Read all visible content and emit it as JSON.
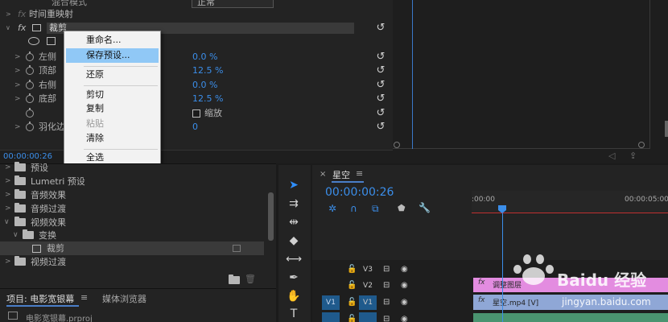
{
  "effect_controls": {
    "blend_label": "混合模式",
    "blend_value": "正常",
    "time_remap": "时间重映射",
    "crop_name": "裁剪",
    "properties": [
      {
        "label": "左侧",
        "value": "0.0 %"
      },
      {
        "label": "顶部",
        "value": "12.5 %"
      },
      {
        "label": "右侧",
        "value": "0.0 %"
      },
      {
        "label": "底部",
        "value": "12.5 %"
      }
    ],
    "zoom_label": "缩放",
    "feather_label": "羽化边",
    "feather_value": "0",
    "timecode": "00:00:00:26",
    "fx_mark": "fx",
    "reset_icon": "↺"
  },
  "context_menu": {
    "items": [
      "重命名...",
      "保存预设...",
      "还原",
      "剪切",
      "复制",
      "粘贴",
      "清除",
      "全选"
    ],
    "highlighted": 1,
    "disabled": [
      5
    ]
  },
  "effects_panel": {
    "items": [
      {
        "label": "预设",
        "level": 0,
        "open": false
      },
      {
        "label": "Lumetri 预设",
        "level": 0,
        "open": false
      },
      {
        "label": "音频效果",
        "level": 0,
        "open": false
      },
      {
        "label": "音频过渡",
        "level": 0,
        "open": false
      },
      {
        "label": "视频效果",
        "level": 0,
        "open": true
      },
      {
        "label": "变换",
        "level": 1,
        "open": true
      },
      {
        "label": "裁剪",
        "level": 2,
        "open": false
      },
      {
        "label": "视频过渡",
        "level": 0,
        "open": false
      }
    ]
  },
  "project_panel": {
    "tab_project": "项目: 电影宽银幕",
    "tab_media": "媒体浏览器",
    "file_name": "电影宽银幕.prproj"
  },
  "timeline": {
    "sequence_name": "星空",
    "timecode": "00:00:00:26",
    "ruler_start": ":00:00",
    "ruler_end": "00:00:05:00",
    "tracks": [
      {
        "name": "V3",
        "src": ""
      },
      {
        "name": "V2",
        "src": ""
      },
      {
        "name": "V1",
        "src": "V1"
      }
    ],
    "clips": [
      {
        "label": "调整图层",
        "track": "V2",
        "color": "#e38ce0"
      },
      {
        "label": "星空.mp4 [V]",
        "track": "V1",
        "color": "#8fa7d6"
      }
    ]
  },
  "watermark": {
    "brand": "Baidu 经验",
    "url": "jingyan.baidu.com"
  }
}
